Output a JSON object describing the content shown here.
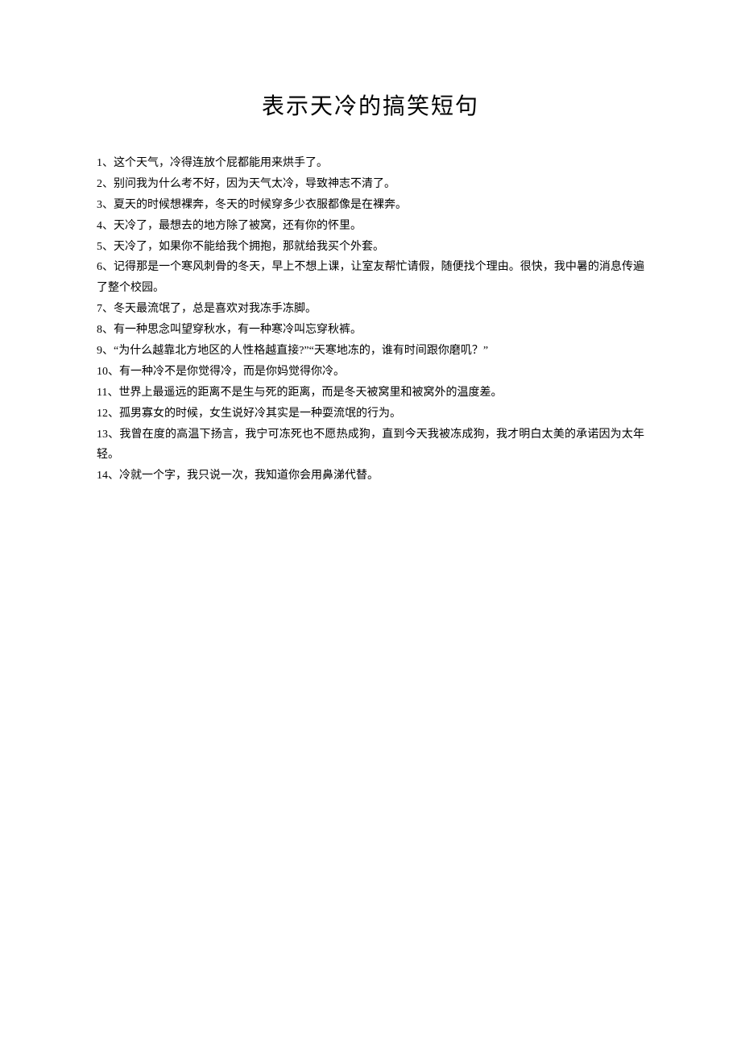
{
  "title": "表示天冷的搞笑短句",
  "items": [
    "1、这个天气，冷得连放个屁都能用来烘手了。",
    "2、别问我为什么考不好，因为天气太冷，导致神志不清了。",
    "3、夏天的时候想裸奔，冬天的时候穿多少衣服都像是在裸奔。",
    "4、天冷了，最想去的地方除了被窝，还有你的怀里。",
    "5、天冷了，如果你不能给我个拥抱，那就给我买个外套。",
    "6、记得那是一个寒风刺骨的冬天，早上不想上课，让室友帮忙请假，随便找个理由。很快，我中暑的消息传遍了整个校园。",
    "7、冬天最流氓了，总是喜欢对我冻手冻脚。",
    "8、有一种思念叫望穿秋水，有一种寒冷叫忘穿秋裤。",
    "9、“为什么越靠北方地区的人性格越直接?”“天寒地冻的，谁有时间跟你磨叽？”",
    "10、有一种冷不是你觉得冷，而是你妈觉得你冷。",
    "11、世界上最遥远的距离不是生与死的距离，而是冬天被窝里和被窝外的温度差。",
    "12、孤男寡女的时候，女生说好冷其实是一种耍流氓的行为。",
    "13、我曾在度的高温下扬言，我宁可冻死也不愿热成狗，直到今天我被冻成狗，我才明白太美的承诺因为太年轻。",
    "14、冷就一个字，我只说一次，我知道你会用鼻涕代替。"
  ]
}
